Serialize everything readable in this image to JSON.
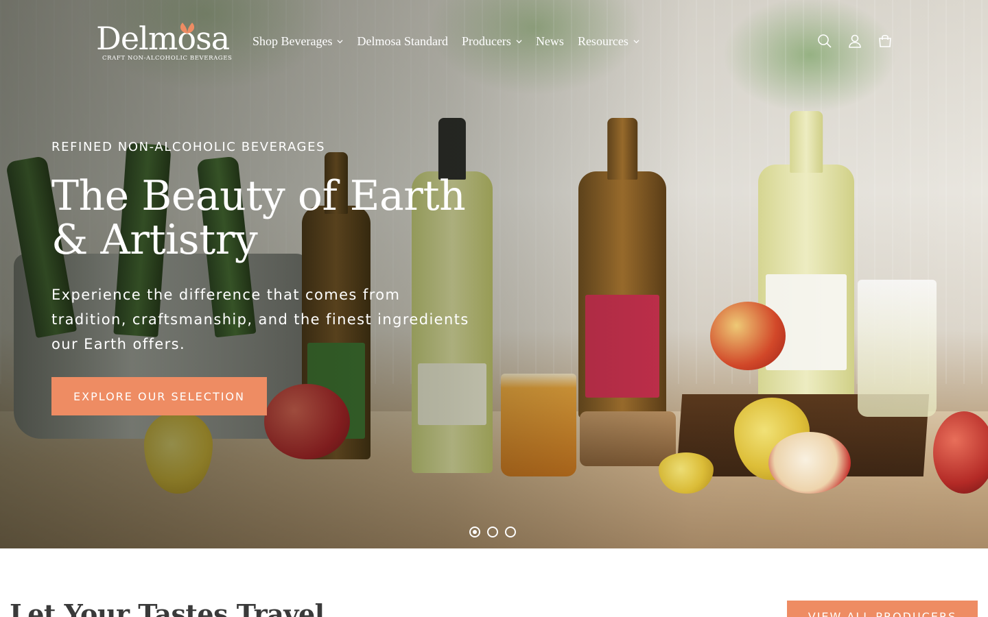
{
  "brand": {
    "name": "Delmosa",
    "tagline": "CRAFT NON-ALCOHOLIC BEVERAGES",
    "accent_color": "#ee8c63"
  },
  "nav": {
    "items": [
      {
        "label": "Shop Beverages",
        "has_dropdown": true
      },
      {
        "label": "Delmosa Standard",
        "has_dropdown": false
      },
      {
        "label": "Producers",
        "has_dropdown": true
      },
      {
        "label": "News",
        "has_dropdown": false
      },
      {
        "label": "Resources",
        "has_dropdown": true
      }
    ]
  },
  "header_icons": [
    "search-icon",
    "account-icon",
    "cart-icon"
  ],
  "hero": {
    "eyebrow": "REFINED NON-ALCOHOLIC BEVERAGES",
    "headline_line1": "The Beauty of Earth",
    "headline_line2": "& Artistry",
    "subtext": "Experience the difference that comes from tradition, craftsmanship, and the finest ingredients our Earth offers.",
    "cta_label": "EXPLORE OUR SELECTION"
  },
  "slider": {
    "slide_count": 3,
    "active_index": 0
  },
  "section": {
    "title": "Let Your Tastes Travel",
    "button_label": "VIEW ALL PRODUCERS"
  }
}
